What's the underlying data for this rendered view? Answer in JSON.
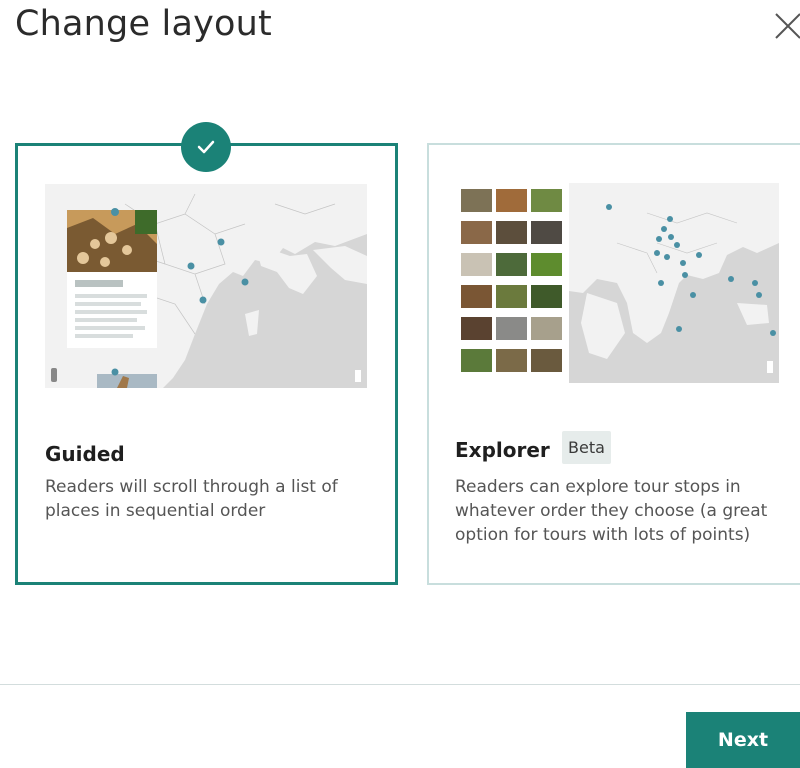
{
  "dialog": {
    "title": "Change layout",
    "close_icon": "close-icon"
  },
  "layouts": [
    {
      "id": "guided",
      "title": "Guided",
      "description": "Readers will scroll through a list of places in sequential order",
      "selected": true
    },
    {
      "id": "explorer",
      "title": "Explorer",
      "badge": "Beta",
      "description": "Readers can explore tour stops in whatever order they choose (a great option for tours with lots of points)",
      "selected": false
    }
  ],
  "footer": {
    "next_label": "Next"
  },
  "colors": {
    "accent": "#1b8277",
    "selected_border": "#1b8277",
    "unselected_border": "#c8dedd",
    "badge_bg": "#e6eceb"
  }
}
